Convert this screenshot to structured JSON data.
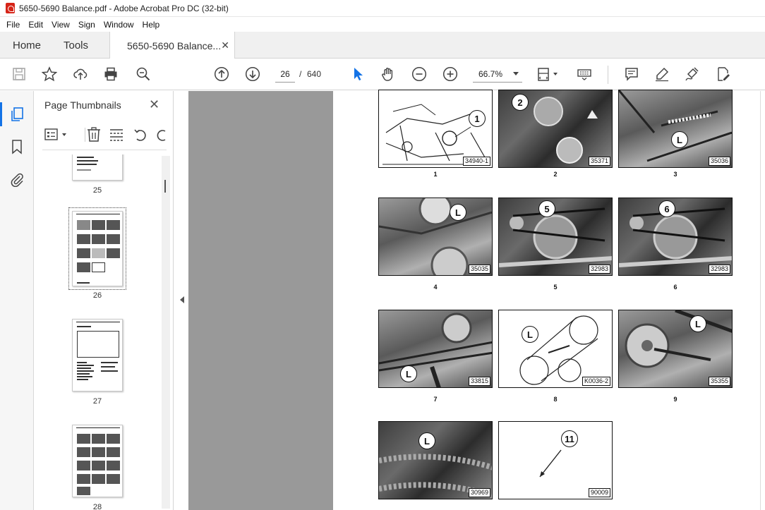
{
  "window": {
    "title": "5650-5690 Balance.pdf - Adobe Acrobat Pro DC (32-bit)"
  },
  "menu": [
    "File",
    "Edit",
    "View",
    "Sign",
    "Window",
    "Help"
  ],
  "tabs": {
    "home": "Home",
    "tools": "Tools",
    "document": "5650-5690 Balance...",
    "close": "✕"
  },
  "toolbar": {
    "page_current": "26",
    "page_separator": "/",
    "page_total": "640",
    "zoom": "66.7%"
  },
  "thumbnails_panel": {
    "title": "Page Thumbnails",
    "close": "✕",
    "pages": [
      {
        "label": "25",
        "selected": false
      },
      {
        "label": "26",
        "selected": true
      },
      {
        "label": "27",
        "selected": false
      },
      {
        "label": "28",
        "selected": false
      }
    ]
  },
  "figures": [
    {
      "caption": "1",
      "code": "34940-1",
      "callout": "1"
    },
    {
      "caption": "2",
      "code": "35371",
      "callout": "2"
    },
    {
      "caption": "3",
      "code": "35036",
      "callout": "L"
    },
    {
      "caption": "4",
      "code": "35035",
      "callout": "L"
    },
    {
      "caption": "5",
      "code": "32983",
      "callout": "5"
    },
    {
      "caption": "6",
      "code": "32983",
      "callout": "6"
    },
    {
      "caption": "7",
      "code": "33815",
      "callout": "L"
    },
    {
      "caption": "8",
      "code": "K0036-2",
      "callout": "L"
    },
    {
      "caption": "9",
      "code": "35355",
      "callout": "L"
    },
    {
      "caption": "",
      "code": "30969",
      "callout": "L"
    },
    {
      "caption": "",
      "code": "90009",
      "callout": "11"
    }
  ]
}
